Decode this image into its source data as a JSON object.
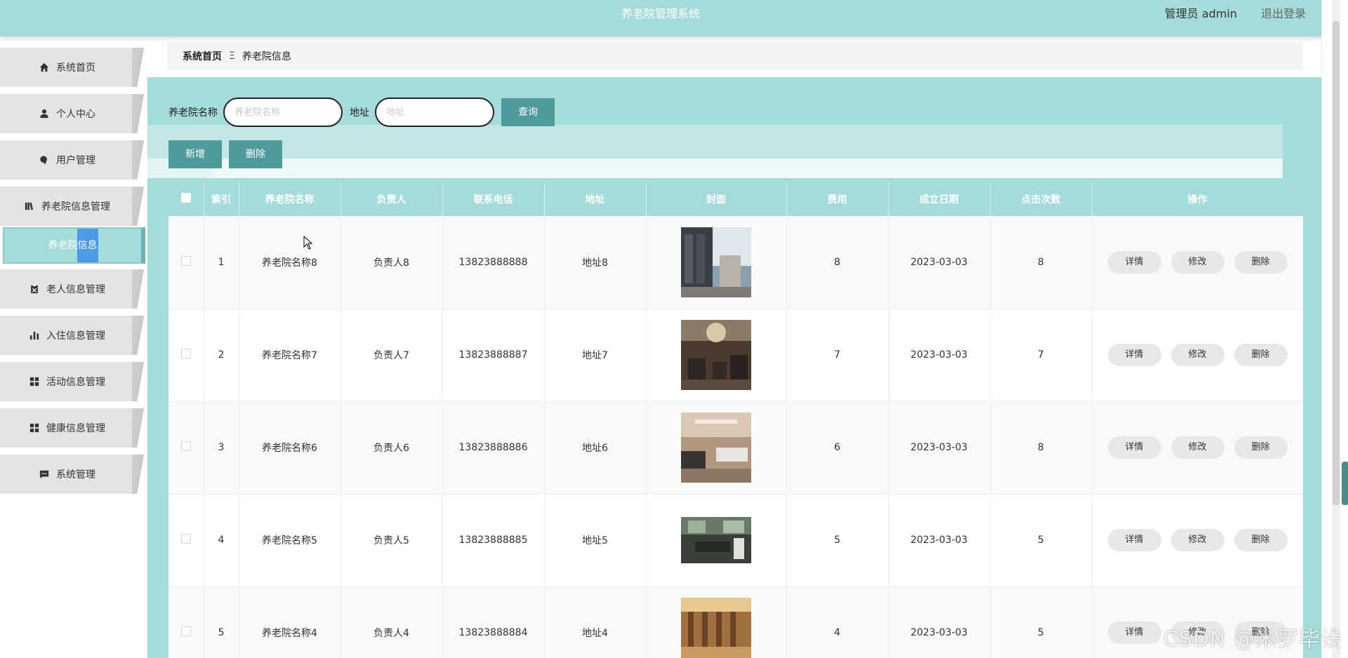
{
  "header": {
    "title": "养老院管理系统",
    "user": "管理员 admin",
    "logout": "退出登录"
  },
  "sidebar": {
    "items": [
      {
        "label": "系统首页",
        "icon": "home-icon"
      },
      {
        "label": "个人中心",
        "icon": "user-icon"
      },
      {
        "label": "用户管理",
        "icon": "pin-icon"
      },
      {
        "label": "养老院信息管理",
        "icon": "book-icon"
      },
      {
        "label": "老人信息管理",
        "icon": "clipboard-icon"
      },
      {
        "label": "入住信息管理",
        "icon": "bar-chart-icon"
      },
      {
        "label": "活动信息管理",
        "icon": "grid-icon"
      },
      {
        "label": "健康信息管理",
        "icon": "grid-icon"
      },
      {
        "label": "系统管理",
        "icon": "chat-icon"
      }
    ],
    "active_sub": "养老院信息"
  },
  "breadcrumb": {
    "home": "系统首页",
    "sep": "Ξ",
    "current": "养老院信息"
  },
  "search": {
    "name_label": "养老院名称",
    "name_placeholder": "养老院名称",
    "addr_label": "地址",
    "addr_placeholder": "地址",
    "query_label": "查询"
  },
  "actions": {
    "add_label": "新增",
    "delete_label": "删除"
  },
  "table": {
    "headers": [
      "索引",
      "养老院名称",
      "负责人",
      "联系电话",
      "地址",
      "封面",
      "费用",
      "成立日期",
      "点击次数",
      "操作"
    ],
    "op_labels": [
      "详情",
      "修改",
      "删除"
    ],
    "rows": [
      {
        "index": "1",
        "name": "养老院名称8",
        "manager": "负责人8",
        "phone": "13823888888",
        "address": "地址8",
        "fee": "8",
        "date": "2023-03-03",
        "clicks": "8"
      },
      {
        "index": "2",
        "name": "养老院名称7",
        "manager": "负责人7",
        "phone": "13823888887",
        "address": "地址7",
        "fee": "7",
        "date": "2023-03-03",
        "clicks": "7"
      },
      {
        "index": "3",
        "name": "养老院名称6",
        "manager": "负责人6",
        "phone": "13823888886",
        "address": "地址6",
        "fee": "6",
        "date": "2023-03-03",
        "clicks": "8"
      },
      {
        "index": "4",
        "name": "养老院名称5",
        "manager": "负责人5",
        "phone": "13823888885",
        "address": "地址5",
        "fee": "5",
        "date": "2023-03-03",
        "clicks": "5"
      },
      {
        "index": "5",
        "name": "养老院名称4",
        "manager": "负责人4",
        "phone": "13823888884",
        "address": "地址4",
        "fee": "4",
        "date": "2023-03-03",
        "clicks": "5"
      }
    ]
  },
  "watermark": "CSDN @米罗毕设",
  "colors": {
    "accent": "#a5dbdb",
    "button": "#4f9a9a"
  }
}
